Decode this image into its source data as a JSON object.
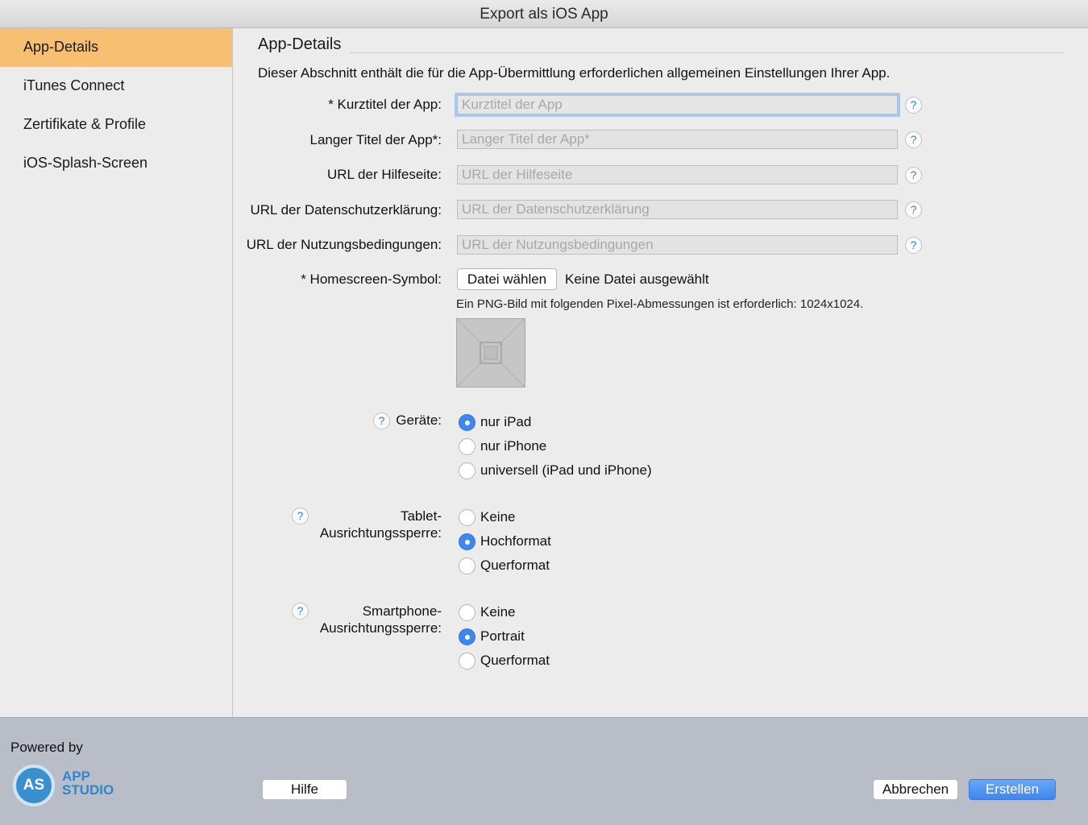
{
  "window": {
    "title": "Export als iOS App"
  },
  "sidebar": {
    "items": [
      {
        "label": "App-Details",
        "active": true
      },
      {
        "label": "iTunes Connect"
      },
      {
        "label": "Zertifikate & Profile"
      },
      {
        "label": "iOS-Splash-Screen"
      }
    ]
  },
  "section": {
    "title": "App-Details",
    "description": "Dieser Abschnitt enthält die für die App-Übermittlung erforderlichen allgemeinen Einstellungen Ihrer App."
  },
  "form": {
    "short_title": {
      "label": "* Kurztitel der App:",
      "placeholder": "Kurztitel der App",
      "value": ""
    },
    "long_title": {
      "label": "Langer Titel der App*:",
      "placeholder": "Langer Titel der App*",
      "value": ""
    },
    "help_url": {
      "label": "URL der Hilfeseite:",
      "placeholder": "URL der Hilfeseite",
      "value": ""
    },
    "privacy_url": {
      "label": "URL der Datenschutzerklärung:",
      "placeholder": "URL der Datenschutzerklärung",
      "value": ""
    },
    "terms_url": {
      "label": "URL der Nutzungsbedingungen:",
      "placeholder": "URL der Nutzungsbedingungen",
      "value": ""
    },
    "homescreen_icon": {
      "label": "* Homescreen-Symbol:",
      "choose_button": "Datei wählen",
      "file_status": "Keine Datei ausgewählt",
      "hint": "Ein PNG-Bild mit folgenden Pixel-Abmessungen ist erforderlich: 1024x1024."
    },
    "devices": {
      "label": "Geräte:",
      "options": [
        "nur iPad",
        "nur iPhone",
        "universell (iPad und iPhone)"
      ],
      "selected": "nur iPad"
    },
    "tablet_lock": {
      "label_line1": "Tablet-",
      "label_line2": "Ausrichtungssperre:",
      "options": [
        "Keine",
        "Hochformat",
        "Querformat"
      ],
      "selected": "Hochformat"
    },
    "phone_lock": {
      "label_line1": "Smartphone-",
      "label_line2": "Ausrichtungssperre:",
      "options": [
        "Keine",
        "Portrait",
        "Querformat"
      ],
      "selected": "Portrait"
    },
    "help_glyph": "?"
  },
  "footer": {
    "powered_by": "Powered by",
    "logo_initials": "AS",
    "logo_line1": "APP",
    "logo_line2": "STUDIO",
    "help_button": "Hilfe",
    "cancel_button": "Abbrechen",
    "create_button": "Erstellen"
  },
  "colors": {
    "accent_sidebar": "#f6bf72",
    "primary_button": "#3f86ee",
    "footer_bg": "#b9bdc8"
  }
}
